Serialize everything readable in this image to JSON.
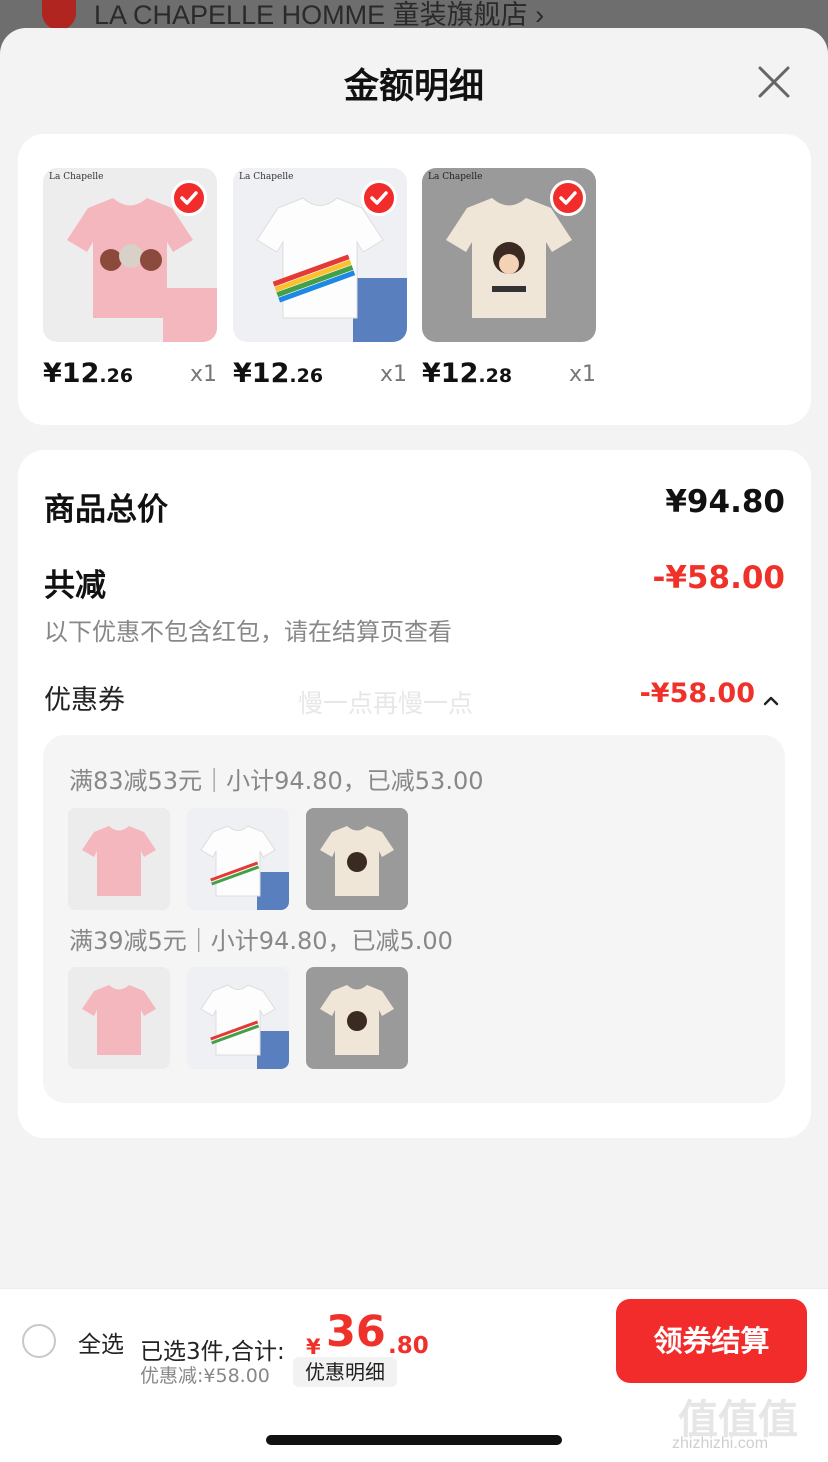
{
  "background": {
    "store_title": "LA CHAPELLE HOMME 童装旗舰店 ›"
  },
  "sheet": {
    "title": "金额明细"
  },
  "products": [
    {
      "brand": "La Chapelle",
      "price_int": "¥12",
      "price_dec": ".26",
      "qty": "x1",
      "color": "#f5b7be",
      "selected": true
    },
    {
      "brand": "La Chapelle",
      "price_int": "¥12",
      "price_dec": ".26",
      "qty": "x1",
      "color": "#f7f8fa",
      "selected": true
    },
    {
      "brand": "La Chapelle",
      "price_int": "¥12",
      "price_dec": ".28",
      "qty": "x1",
      "color": "#efe6d7",
      "selected": true
    }
  ],
  "breakdown": {
    "total_label": "商品总价",
    "total_value": "¥94.80",
    "discount_label": "共减",
    "discount_value": "-¥58.00",
    "note": "以下优惠不包含红包，请在结算页查看",
    "coupon_label": "优惠券",
    "coupon_value": "-¥58.00",
    "watermark": "慢一点再慢一点",
    "rules": [
      {
        "text": "满83减53元｜小计94.80，已减53.00"
      },
      {
        "text": "满39减5元｜小计94.80，已减5.00"
      }
    ]
  },
  "bottom": {
    "select_all": "全选",
    "selected_text": "已选3件,合计:",
    "total_currency": "¥",
    "total_int": "36",
    "total_dec": ".80",
    "discount": "优惠减:¥58.00",
    "detail_link": "优惠明细",
    "checkout": "领券结算"
  },
  "watermark_site": {
    "mark": "值值值",
    "url": "zhizhizhi.com"
  },
  "colors": {
    "accent": "#f22b2b",
    "price_red": "#f0312a"
  }
}
